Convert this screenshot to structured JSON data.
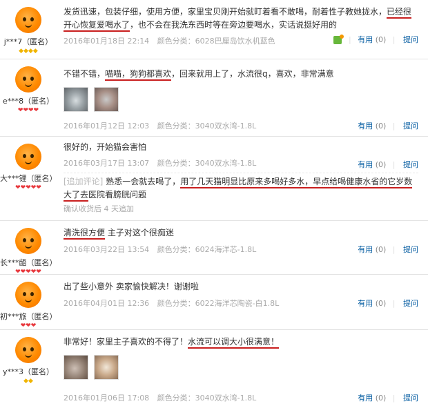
{
  "reviews": [
    {
      "user": "j***7（匿名）",
      "badge": "◆◆◆◆",
      "text_1": "发货迅速，包装仔细，使用方便，家里宝贝刚开始就盯着看不敢喝，耐着性子教她拢水，",
      "text_hl": "已经很开心恢复爱喝水了",
      "text_2": "，也不会在我洗东西时等在旁边要喝水，实话说挺好用的",
      "date": "2016年01月18日 22:14",
      "sku": "颜色分类：6028巴厘岛饮水机蓝色",
      "useful": "有用",
      "useful_count": "(0)",
      "reply": "提问"
    },
    {
      "user": "e***8（匿名）",
      "badge": "❤❤❤❤",
      "text_1": "不错不错，",
      "text_hl": "喵喵，狗狗都喜欢",
      "text_2": "，回来就用上了，水流很q，喜欢，非常满意",
      "date": "2016年01月12日 12:03",
      "sku": "颜色分类：3040双水湾-1.8L",
      "useful": "有用",
      "useful_count": "(0)",
      "reply": "提问"
    },
    {
      "user": "大***锂（匿名）",
      "badge": "❤❤❤❤❤",
      "text": "很好的，开始猫会害怕",
      "date": "2016年03月17日 13:07",
      "sku": "颜色分类：3040双水湾-1.8L",
      "append_tag": "[追加评论]",
      "append_1": "熟悉一会就去喝了，",
      "append_hl": "用了几天猫明显比原来多喝好多水，早点给喝健康水省的它岁数大了去",
      "append_2": "医院看膀胱问题",
      "append_time": "确认收货后 4 天追加",
      "useful": "有用",
      "useful_count": "(0)",
      "reply": "提问"
    },
    {
      "user": "长***龉（匿名）",
      "badge": "❤❤❤❤❤",
      "text_hl": "清洗很方便",
      "text_2": " 主子对这个很痴迷",
      "date": "2016年03月22日 13:54",
      "sku": "颜色分类：6024海洋芯-1.8L",
      "useful": "有用",
      "useful_count": "(0)",
      "reply": "提问"
    },
    {
      "user": "初***旅（匿名）",
      "badge": "❤❤❤",
      "text": "出了些小意外 卖家愉快解决！谢谢啦",
      "date": "2016年04月01日 12:36",
      "sku": "颜色分类：6022海洋芯陶瓷-白1.8L",
      "useful": "有用",
      "useful_count": "(0)",
      "reply": "提问"
    },
    {
      "user": "y***3（匿名）",
      "badge": "◆◆",
      "text_1": "非常好！家里主子喜欢的不得了！",
      "text_hl": "水流可以调大小很满意！",
      "date": "2016年01月06日 17:08",
      "sku": "颜色分类：3040双水湾-1.8L",
      "useful": "有用",
      "useful_count": "(0)",
      "reply": "提问"
    }
  ]
}
